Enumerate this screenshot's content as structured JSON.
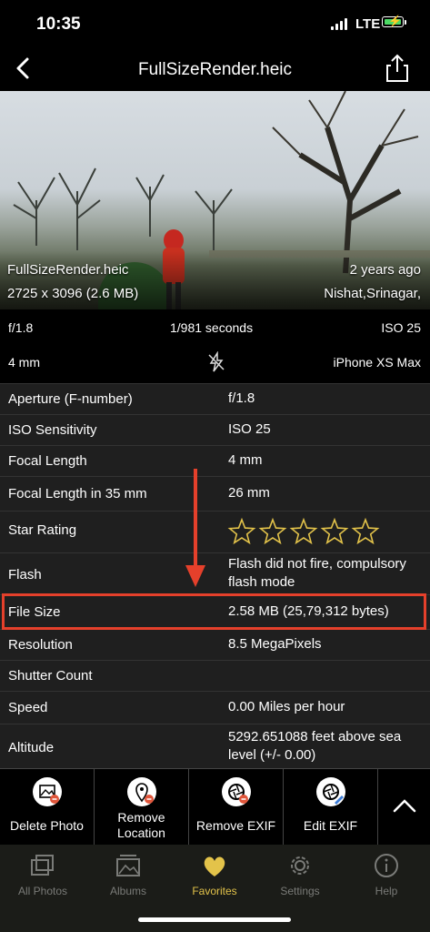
{
  "status": {
    "time": "10:35",
    "network": "LTE"
  },
  "nav": {
    "title": "FullSizeRender.heic"
  },
  "photo": {
    "filename": "FullSizeRender.heic",
    "dimensions": "2725 x 3096 (2.6 MB)",
    "time_ago": "2 years ago",
    "location": "Nishat,Srinagar,"
  },
  "summary": {
    "aperture": "f/1.8",
    "shutter": "1/981 seconds",
    "iso": "ISO 25",
    "focal": "4 mm",
    "device": "iPhone XS Max"
  },
  "exif": [
    {
      "key": "Aperture (F-number)",
      "value": "f/1.8"
    },
    {
      "key": "ISO Sensitivity",
      "value": "ISO 25"
    },
    {
      "key": "Focal Length",
      "value": "4 mm"
    },
    {
      "key": "Focal Length in 35 mm",
      "value": "26 mm"
    },
    {
      "key": "Star Rating",
      "value": ""
    },
    {
      "key": "Flash",
      "value": "Flash did not fire, compulsory flash mode"
    },
    {
      "key": "File Size",
      "value": "2.58 MB (25,79,312 bytes)"
    },
    {
      "key": "Resolution",
      "value": "8.5 MegaPixels"
    },
    {
      "key": "Shutter Count",
      "value": ""
    },
    {
      "key": "Speed",
      "value": "0.00 Miles per hour"
    },
    {
      "key": "Altitude",
      "value": "5292.651088 feet above sea level (+/- 0.00)"
    }
  ],
  "star_rating": {
    "stars": 0,
    "max": 5
  },
  "toolbar": {
    "delete_photo": "Delete Photo",
    "remove_location": "Remove Location",
    "remove_exif": "Remove EXIF",
    "edit_exif": "Edit EXIF"
  },
  "tabs": [
    {
      "label": "All Photos",
      "icon": "photos-icon"
    },
    {
      "label": "Albums",
      "icon": "albums-icon"
    },
    {
      "label": "Favorites",
      "icon": "heart-icon"
    },
    {
      "label": "Settings",
      "icon": "gear-icon"
    },
    {
      "label": "Help",
      "icon": "info-icon"
    }
  ],
  "colors": {
    "accent": "#e3c34a",
    "highlight": "#e5402b",
    "heart": "#e0553a"
  }
}
